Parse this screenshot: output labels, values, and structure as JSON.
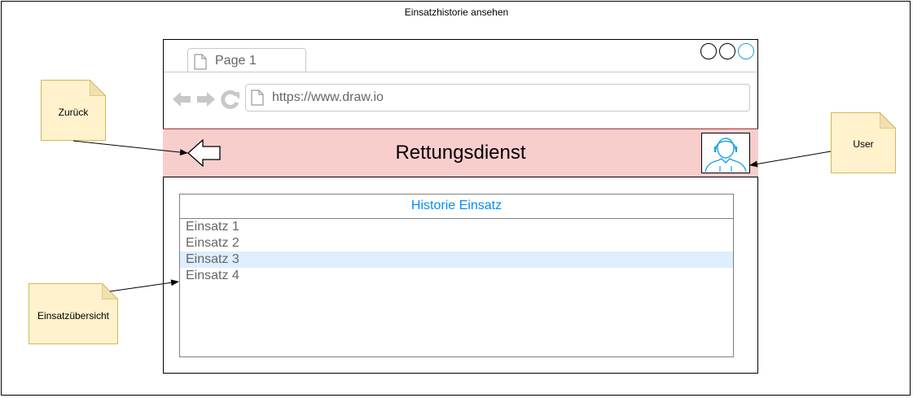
{
  "diagram": {
    "title": "Einsatzhistorie ansehen"
  },
  "browser": {
    "tab_label": "Page 1",
    "url": "https://www.draw.io",
    "window_controls": [
      "minimize",
      "restore",
      "maximize"
    ]
  },
  "app": {
    "header_title": "Rettungsdienst",
    "header_color": "#f8cecc",
    "icons": {
      "back": "back-arrow-icon",
      "user": "user-avatar-icon"
    }
  },
  "history_list": {
    "title": "Historie Einsatz",
    "title_color": "#008cff",
    "items": [
      {
        "label": "Einsatz 1",
        "selected": false
      },
      {
        "label": "Einsatz 2",
        "selected": false
      },
      {
        "label": "Einsatz 3",
        "selected": true
      },
      {
        "label": "Einsatz 4",
        "selected": false
      }
    ],
    "selected_color": "#ddeeff"
  },
  "notes": {
    "back": "Zurück",
    "user": "User",
    "overview": "Einsatzübersicht",
    "fill_color": "#fff2cc",
    "stroke_color": "#d6b656"
  }
}
